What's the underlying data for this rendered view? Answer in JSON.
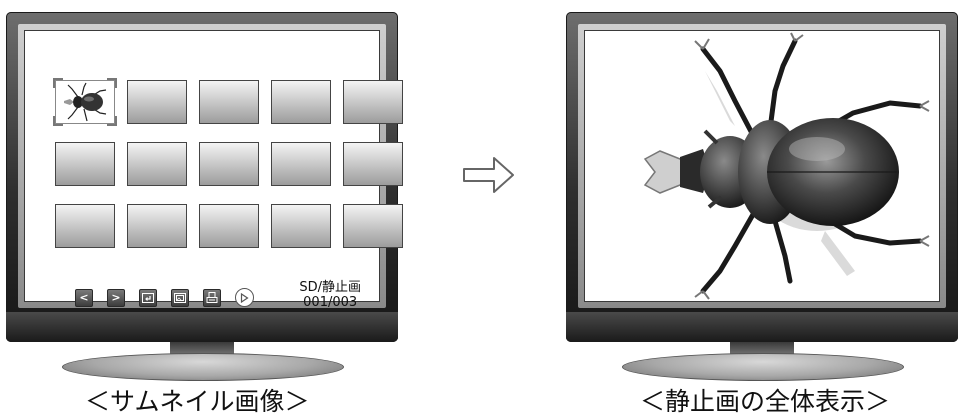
{
  "left_display": {
    "caption": "＜サムネイル画像＞",
    "thumbnails": [
      {
        "selected": true
      },
      {
        "selected": false
      },
      {
        "selected": false
      },
      {
        "selected": false
      },
      {
        "selected": false
      },
      {
        "selected": false
      },
      {
        "selected": false
      },
      {
        "selected": false
      },
      {
        "selected": false
      },
      {
        "selected": false
      },
      {
        "selected": false
      },
      {
        "selected": false
      },
      {
        "selected": false
      },
      {
        "selected": false
      },
      {
        "selected": false
      }
    ],
    "toolbar": {
      "prev_label": "<",
      "next_label": ">",
      "return_icon": "return-icon",
      "slideshow_icon": "image-icon",
      "print_icon": "printer-icon",
      "play_label": "▷"
    },
    "status": {
      "source": "SD/静止画",
      "counter": "001/003"
    }
  },
  "transition_arrow_icon": "right-arrow-icon",
  "right_display": {
    "caption": "＜静止画の全体表示＞"
  },
  "colors": {
    "bezel_dark": "#161616",
    "screen_bg": "#ffffff",
    "thumb_gradient_top": "#f4f4f4",
    "thumb_gradient_bottom": "#9c9c9c"
  }
}
